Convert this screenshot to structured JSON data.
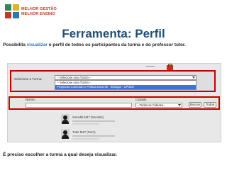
{
  "logo": {
    "line1": "MELHOR GESTÃO",
    "line2": "MELHOR ENSINO",
    "accent": "#c0392b"
  },
  "slide": {
    "title": "Ferramenta: Perfil",
    "subtitle_before": "Possibilita ",
    "subtitle_highlight": "visualizar",
    "subtitle_after": " o perfil de todos os participantes da turma e do professor tutor.",
    "footer": "É preciso escolher a turma a qual deseja visualizar.",
    "title_color": "#1f4e79",
    "highlight_color": "#2e75b6",
    "frame_color": "#c00000"
  },
  "filter": {
    "label": "Selecione a Turma:",
    "selected": "-- Selecione uma Turma --",
    "options": [
      "-- Selecione uma Turma --",
      "Programa Conteúdo e Prática Docente - Biologia - CP0047"
    ],
    "highlighted_option_index": 1
  },
  "search": {
    "name_label": "Nome:",
    "name_value": "",
    "city_label": "Cidade:",
    "city_selected": "--Todas as Cidades--",
    "search_button": "Buscar",
    "all_button": "Todos"
  },
  "results": [
    {
      "name": "Somebit M47 (Somebit)"
    },
    {
      "name": "Tutor M47 (Tutor)"
    }
  ]
}
